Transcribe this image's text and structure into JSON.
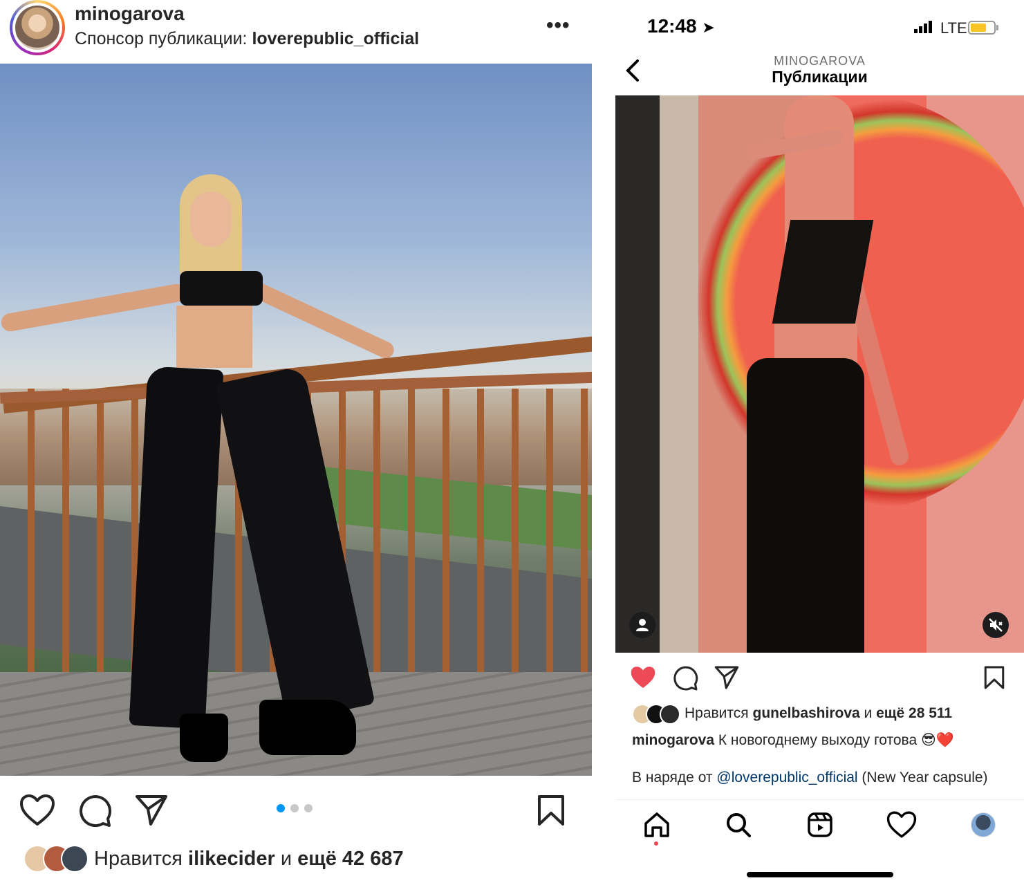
{
  "left_post": {
    "username": "minogarova",
    "sponsor_prefix": "Спонсор публикации: ",
    "sponsor_name": "loverepublic_official",
    "more_label": "•••",
    "carousel": {
      "count": 3,
      "active_index": 0
    },
    "likes": {
      "prefix": "Нравится ",
      "user": "ilikecider",
      "middle": " и ",
      "rest": "ещё 42 687"
    },
    "icons": [
      "heart-icon",
      "comment-icon",
      "share-icon",
      "bookmark-icon"
    ]
  },
  "right_app": {
    "status": {
      "time": "12:48",
      "network": "LTE"
    },
    "header": {
      "account": "MINOGAROVA",
      "title": "Публикации"
    },
    "post": {
      "likes": {
        "prefix": "Нравится ",
        "user": "gunelbashirova",
        "middle": " и ",
        "rest": "ещё 28 511"
      },
      "caption_user": "minogarova",
      "caption_text": " К новогоднему выходу готова 😎❤️",
      "caption2_prefix": "В наряде от ",
      "caption2_mention": "@loverepublic_official",
      "caption2_suffix": " (New Year capsule)",
      "liked": true
    },
    "tabs": [
      "home-icon",
      "search-icon",
      "reels-icon",
      "activity-icon",
      "profile-avatar"
    ]
  },
  "colors": {
    "text": "#262626",
    "accent_blue": "#0095f6",
    "like_red": "#ed4956",
    "mention": "#00376b"
  }
}
